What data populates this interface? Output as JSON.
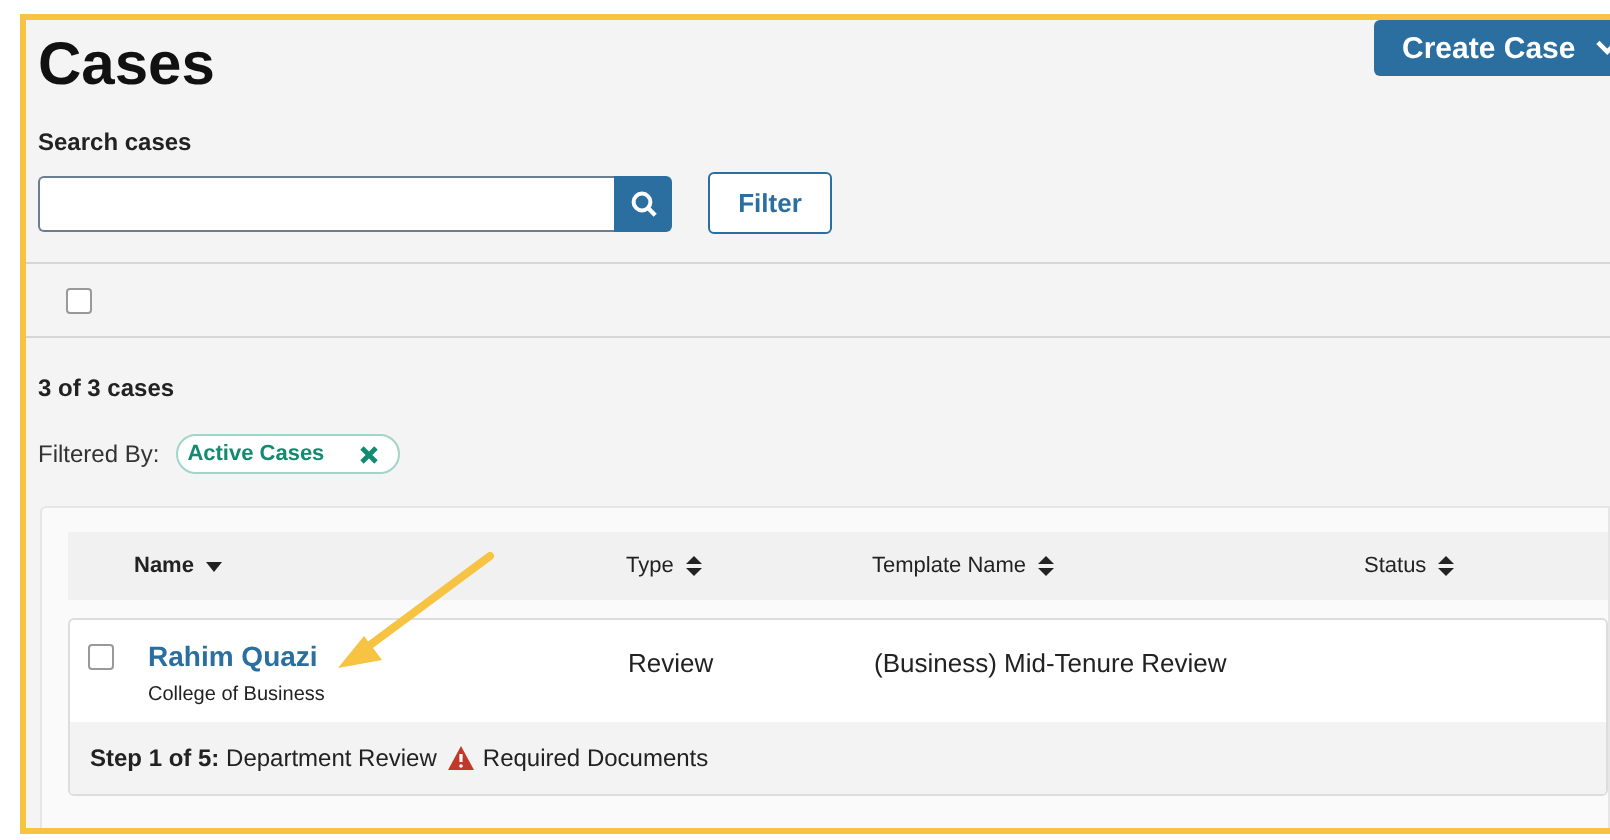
{
  "title": "Cases",
  "create_button": {
    "label": "Create Case"
  },
  "search": {
    "label": "Search cases"
  },
  "filter_button": {
    "label": "Filter"
  },
  "select_all": {
    "checked": false
  },
  "count": "3 of 3 cases",
  "filter": {
    "label": "Filtered By:",
    "chips": [
      {
        "label": "Active Cases"
      }
    ]
  },
  "table": {
    "columns": [
      {
        "label": "Name",
        "sorted": true
      },
      {
        "label": "Type",
        "sorted": false
      },
      {
        "label": "Template Name",
        "sorted": false
      },
      {
        "label": "Status",
        "sorted": false
      }
    ],
    "rows": [
      {
        "checked": false,
        "name": "Rahim Quazi",
        "subtitle": "College of Business",
        "type": "Review",
        "template": "(Business) Mid-Tenure Review",
        "step": "**Step 1 of 5:** Department Review",
        "warning": "Required Documents"
      }
    ]
  }
}
